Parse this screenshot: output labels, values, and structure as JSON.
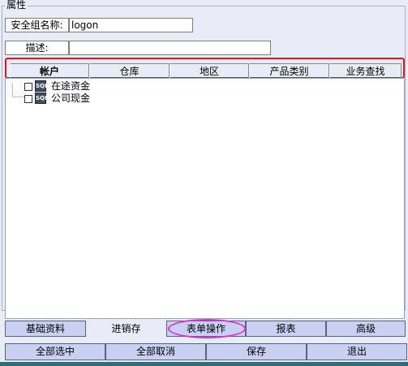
{
  "group": {
    "title": "属性"
  },
  "form": {
    "security_group_label": "安全组名称:",
    "security_group_value": "logon",
    "description_label": "描述:",
    "description_value": ""
  },
  "tabs": [
    {
      "label": "帐户",
      "active": true
    },
    {
      "label": "仓库",
      "active": false
    },
    {
      "label": "地区",
      "active": false
    },
    {
      "label": "产品类别",
      "active": false
    },
    {
      "label": "业务查找",
      "active": false
    }
  ],
  "tree": {
    "items": [
      {
        "label": "在途资金",
        "icon": "db-folder-icon"
      },
      {
        "label": "公司现金",
        "icon": "db-folder-icon"
      }
    ]
  },
  "module_tabs": [
    {
      "label": "基础资料"
    },
    {
      "label": "进销存"
    },
    {
      "label": "表单操作"
    },
    {
      "label": "报表"
    },
    {
      "label": "高级"
    }
  ],
  "actions": [
    {
      "label": "全部选中"
    },
    {
      "label": "全部取消"
    },
    {
      "label": "保存"
    },
    {
      "label": "退出"
    }
  ],
  "colors": {
    "tab_outline": "#e8141e",
    "ellipse_highlight": "#e030d8",
    "button_bg": "#c8d1f2"
  }
}
